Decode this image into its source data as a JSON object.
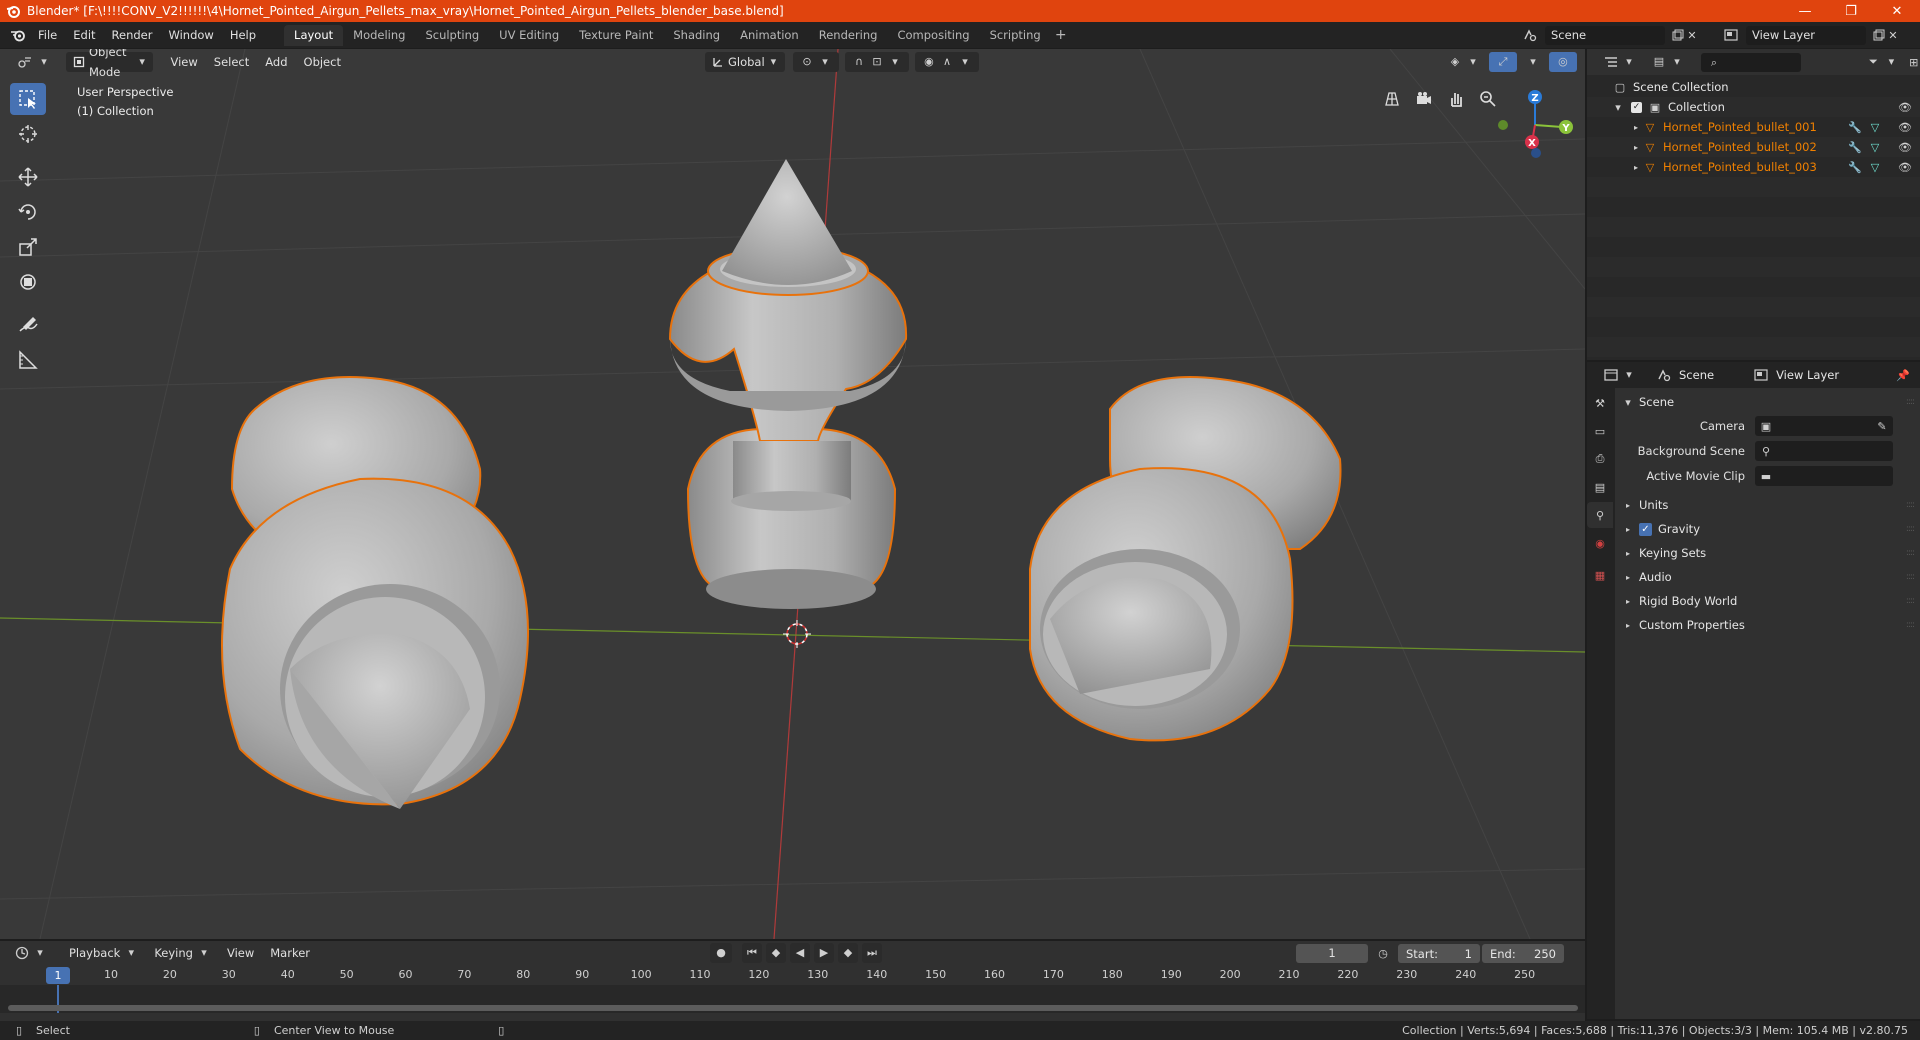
{
  "window": {
    "title": "Blender* [F:\\!!!!CONV_V2!!!!!!\\4\\Hornet_Pointed_Airgun_Pellets_max_vray\\Hornet_Pointed_Airgun_Pellets_blender_base.blend]",
    "minimize": "—",
    "maximize": "❐",
    "close": "✕"
  },
  "menubar": {
    "items": [
      "File",
      "Edit",
      "Render",
      "Window",
      "Help"
    ],
    "workspaces": [
      "Layout",
      "Modeling",
      "Sculpting",
      "UV Editing",
      "Texture Paint",
      "Shading",
      "Animation",
      "Rendering",
      "Compositing",
      "Scripting"
    ],
    "active_workspace": "Layout",
    "add_tab": "+",
    "scene_name": "Scene",
    "view_layer_name": "View Layer"
  },
  "viewport": {
    "mode": "Object Mode",
    "menus": [
      "View",
      "Select",
      "Add",
      "Object"
    ],
    "orientation": "Global",
    "overlay_line1": "User Perspective",
    "overlay_line2": "(1) Collection",
    "gizmo": {
      "z": "Z",
      "y": "Y",
      "x": "X"
    }
  },
  "timeline": {
    "menus": [
      "Playback",
      "Keying",
      "View",
      "Marker"
    ],
    "current_frame": "1",
    "start_label": "Start:",
    "start": "1",
    "end_label": "End:",
    "end": "250",
    "ruler": [
      "1",
      "10",
      "20",
      "30",
      "40",
      "50",
      "60",
      "70",
      "80",
      "90",
      "100",
      "110",
      "120",
      "130",
      "140",
      "150",
      "160",
      "170",
      "180",
      "190",
      "200",
      "210",
      "220",
      "230",
      "240",
      "250"
    ]
  },
  "statusbar": {
    "select": "Select",
    "center_view": "Center View to Mouse",
    "stats": "Collection | Verts:5,694 | Faces:5,688 | Tris:11,376 | Objects:3/3 | Mem: 105.4 MB | v2.80.75"
  },
  "outliner": {
    "scene_collection": "Scene Collection",
    "collection": "Collection",
    "objects": [
      "Hornet_Pointed_bullet_001",
      "Hornet_Pointed_bullet_002",
      "Hornet_Pointed_bullet_003"
    ]
  },
  "properties": {
    "tab_scene": "Scene",
    "tab_view_layer": "View Layer",
    "panel_scene": "Scene",
    "camera_label": "Camera",
    "background_scene_label": "Background Scene",
    "active_movie_clip_label": "Active Movie Clip",
    "panels": [
      "Units",
      "Gravity",
      "Keying Sets",
      "Audio",
      "Rigid Body World",
      "Custom Properties"
    ],
    "gravity_checked": true
  },
  "colors": {
    "accent": "#4772b3",
    "selection": "#f08000",
    "titlebar": "#e0440e"
  }
}
